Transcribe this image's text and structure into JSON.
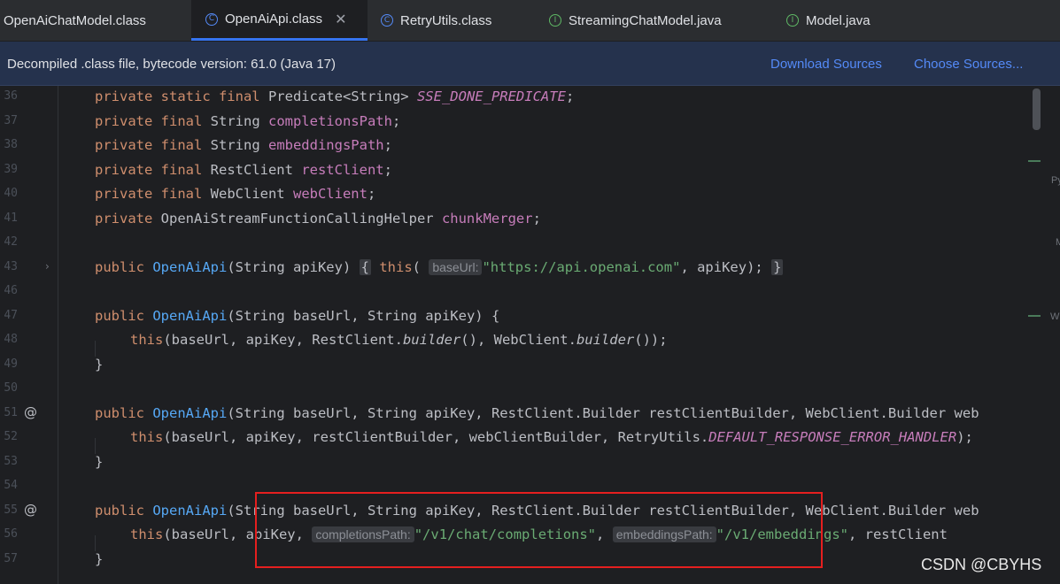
{
  "tabs": [
    {
      "label": "OpenAiChatModel.class",
      "icon": "class-icon",
      "active": false
    },
    {
      "label": "OpenAiApi.class",
      "icon": "class-icon",
      "active": true
    },
    {
      "label": "RetryUtils.class",
      "icon": "class-icon",
      "active": false
    },
    {
      "label": "StreamingChatModel.java",
      "icon": "interface-icon",
      "active": false
    },
    {
      "label": "Model.java",
      "icon": "interface-icon",
      "active": false
    }
  ],
  "banner": {
    "text": "Decompiled .class file, bytecode version: 61.0 (Java 17)",
    "download_label": "Download Sources",
    "choose_label": "Choose Sources..."
  },
  "line_numbers": [
    "36",
    "37",
    "38",
    "39",
    "40",
    "41",
    "42",
    "43",
    "46",
    "47",
    "48",
    "49",
    "50",
    "51",
    "52",
    "53",
    "54",
    "55",
    "56",
    "57"
  ],
  "hints": {
    "base_url": "baseUrl:",
    "completions_path": "completionsPath:",
    "embeddings_path": "embeddingsPath:"
  },
  "side_letters": [
    "Py",
    "M",
    "W"
  ],
  "watermark": "CSDN @CBYHS",
  "colors": {
    "keyword": "#cf8e6d",
    "field": "#c77dbb",
    "method": "#56a8f5",
    "string": "#6aab73",
    "accent": "#3574f0",
    "highlight_box": "#e51f1f"
  }
}
